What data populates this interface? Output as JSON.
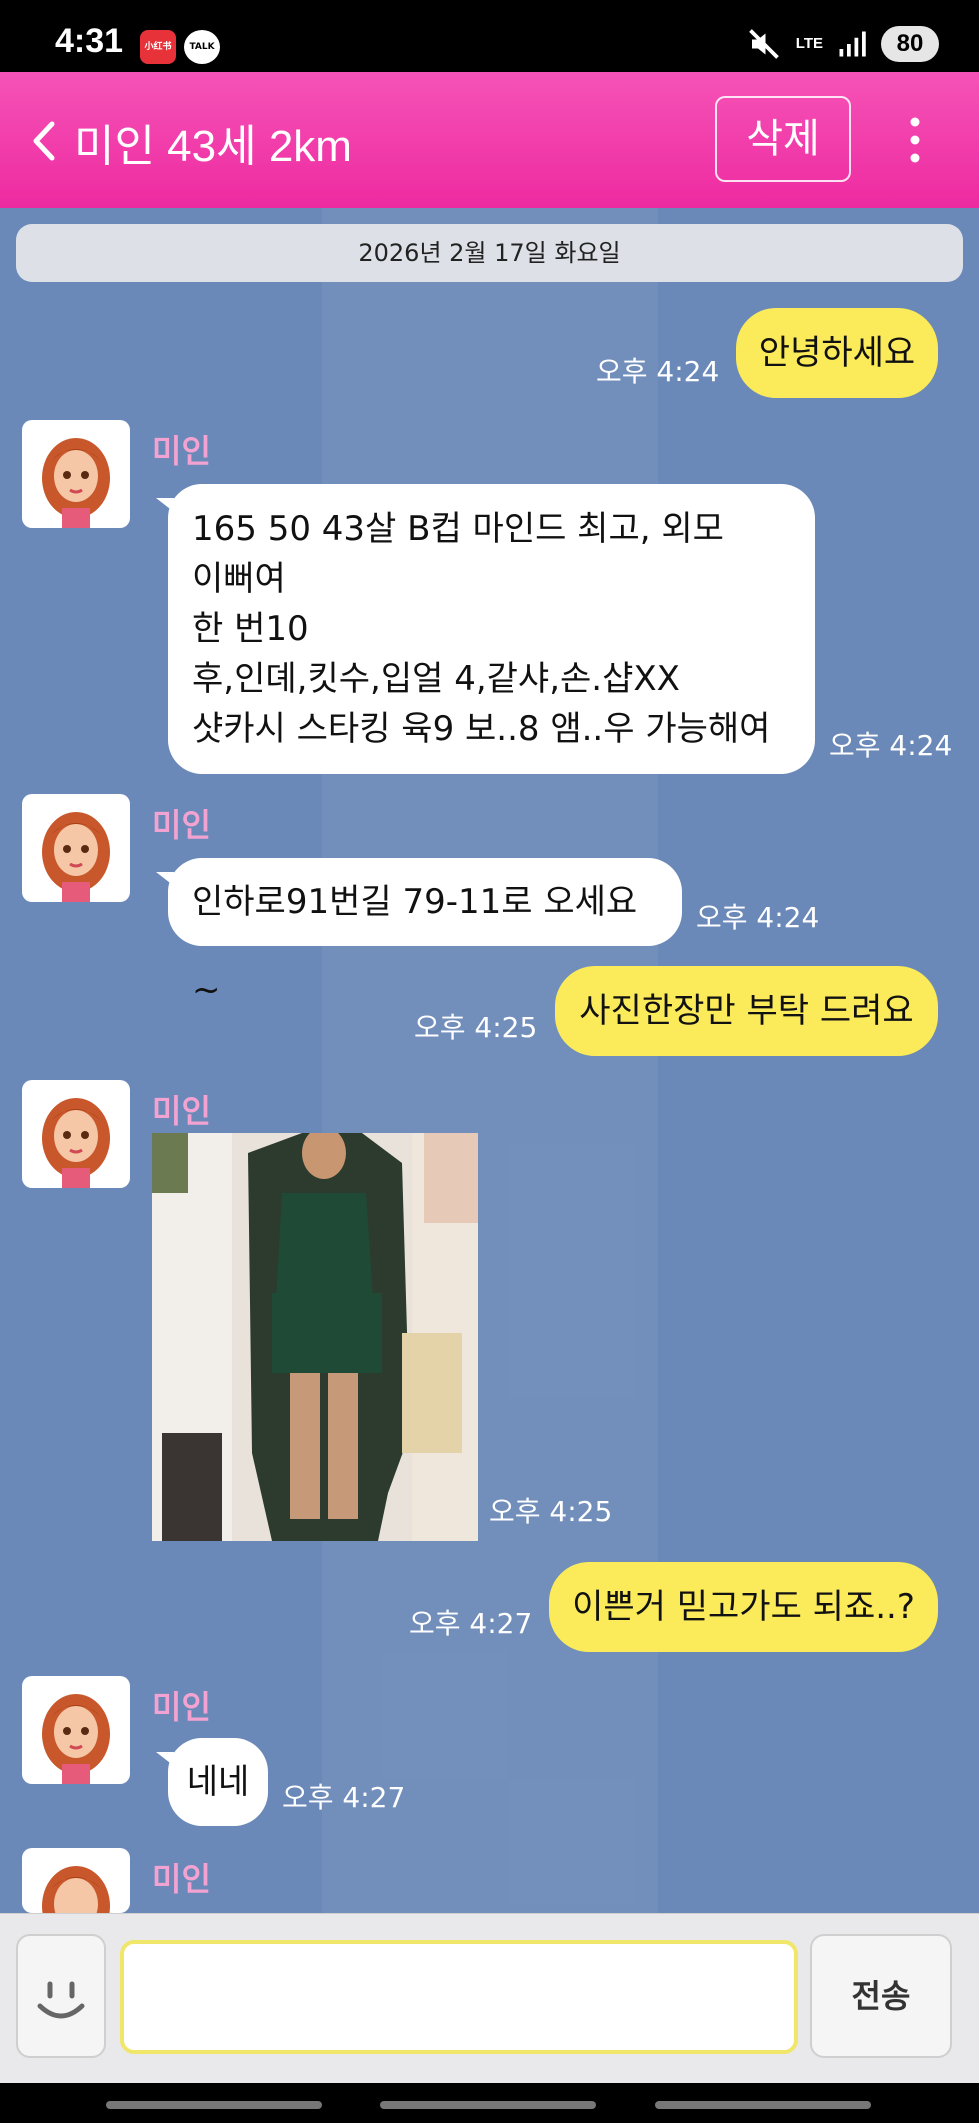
{
  "status_bar": {
    "time": "4:31",
    "app_icon_1": "小红书",
    "app_icon_2": "TALK",
    "lte": "LTE",
    "battery": "80"
  },
  "header": {
    "title": "미인 43세 2km",
    "delete_label": "삭제"
  },
  "date_divider": "2026년 2월 17일 화요일",
  "sender_name": "미인",
  "messages": [
    {
      "from": "me",
      "text": "안녕하세요",
      "time": "오후 4:24"
    },
    {
      "from": "them",
      "lines": [
        "165 50 43살  B컵 마인드 최고, 외모",
        "이뻐여",
        "한 번10",
        "후,인뎨,킷수,입얼 4,같샤,손.샵XX",
        "샷카시 스타킹 육9 보..8 앰..우 가능해여"
      ],
      "time": "오후 4:24"
    },
    {
      "from": "them",
      "text": "인하로91번길 79-11로 오세요~",
      "time": "오후 4:24"
    },
    {
      "from": "me",
      "text": "사진한장만 부탁 드려요",
      "time": "오후 4:25"
    },
    {
      "from": "them",
      "type": "photo",
      "time": "오후 4:25"
    },
    {
      "from": "me",
      "text": "이쁜거 믿고가도 되죠..?",
      "time": "오후 4:27"
    },
    {
      "from": "them",
      "text": "네네",
      "time": "오후 4:27"
    }
  ],
  "input": {
    "value": "",
    "send_label": "전송"
  },
  "colors": {
    "header": "#ee2aa0",
    "background": "#6b89b8",
    "my_bubble": "#fbeb5a",
    "their_bubble": "#ffffff",
    "sender_name": "#f2a3d1"
  },
  "icons": [
    "back-arrow-icon",
    "more-vertical-icon",
    "emoji-icon",
    "mute-icon",
    "signal-icon"
  ]
}
